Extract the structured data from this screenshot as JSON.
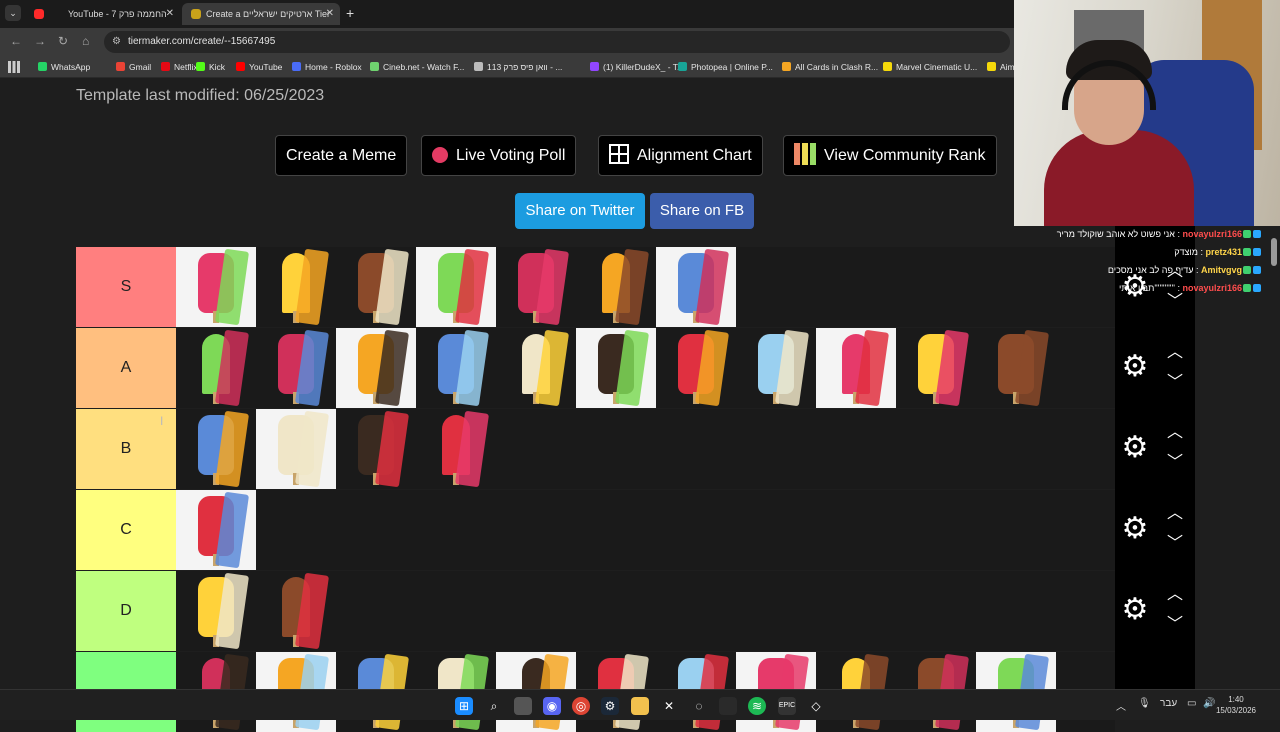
{
  "browser": {
    "tabs": [
      {
        "title": "YouTube - החממה פרק 7",
        "active": false
      },
      {
        "title": "Create a ארטיקים ישראליים Tier",
        "active": true
      }
    ],
    "url": "tiermaker.com/create/--15667495",
    "bookmarks": [
      {
        "label": "WhatsApp",
        "icon": "whatsapp-icon",
        "color": "#25d366"
      },
      {
        "label": "Gmail",
        "icon": "gmail-icon",
        "color": "#ea4335"
      },
      {
        "label": "Netflix",
        "icon": "netflix-icon",
        "color": "#e50914"
      },
      {
        "label": "Kick",
        "icon": "kick-icon",
        "color": "#53fc18"
      },
      {
        "label": "YouTube",
        "icon": "youtube-icon",
        "color": "#ff0000"
      },
      {
        "label": "Home - Roblox",
        "icon": "roblox-icon",
        "color": "#4a6cf7"
      },
      {
        "label": "Cineb.net - Watch F...",
        "icon": "cineb-icon",
        "color": "#6fd36f"
      },
      {
        "label": "וואן פיס פרק 113 - ...",
        "icon": "globe-icon",
        "color": "#bbbbbb"
      },
      {
        "label": "(1) KillerDudeX_ - T...",
        "icon": "twitch-icon",
        "color": "#9146ff"
      },
      {
        "label": "Photopea | Online P...",
        "icon": "photopea-icon",
        "color": "#18a497"
      },
      {
        "label": "All Cards in Clash R...",
        "icon": "clash-icon",
        "color": "#f5a623"
      },
      {
        "label": "Marvel Cinematic U...",
        "icon": "marvel-icon",
        "color": "#f5d90a"
      },
      {
        "label": "Aim",
        "icon": "aim-icon",
        "color": "#f5d90a"
      }
    ]
  },
  "page": {
    "template_modified": "Template last modified: 06/25/2023",
    "buttons": {
      "create_meme": "Create a Meme",
      "live_voting": "Live Voting Poll",
      "alignment_chart": "Alignment Chart",
      "community_rank": "View Community Rank"
    },
    "share": {
      "twitter": "Share on Twitter",
      "facebook": "Share on FB"
    }
  },
  "tiers": [
    {
      "label": "S",
      "color": "#ff7f7f",
      "item_count": 7
    },
    {
      "label": "A",
      "color": "#ffbf7f",
      "item_count": 11
    },
    {
      "label": "B",
      "color": "#ffdf7f",
      "item_count": 4
    },
    {
      "label": "C",
      "color": "#ffff7f",
      "item_count": 1
    },
    {
      "label": "D",
      "color": "#bfff7f",
      "item_count": 2
    },
    {
      "label": "",
      "color": "#7fff7f",
      "item_count": 11
    }
  ],
  "chat": [
    {
      "user": "novayulzri166",
      "text": "אני פשוט לא אוהב שוקולד מריר",
      "user_color": "#ff4d4d"
    },
    {
      "user": "pretz431",
      "text": "מוצדק",
      "user_color": "#ffd54a"
    },
    {
      "user": "Amitvgvg",
      "text": "עדיף פה לב אני מסכים",
      "user_color": "#ffd54a"
    },
    {
      "user": "novayulzri166",
      "text": "תבין אותי''''''''''''",
      "user_color": "#ff4d4d"
    }
  ],
  "taskbar": {
    "language": "עבר",
    "time": "1:40",
    "date": "15/03/2026"
  }
}
